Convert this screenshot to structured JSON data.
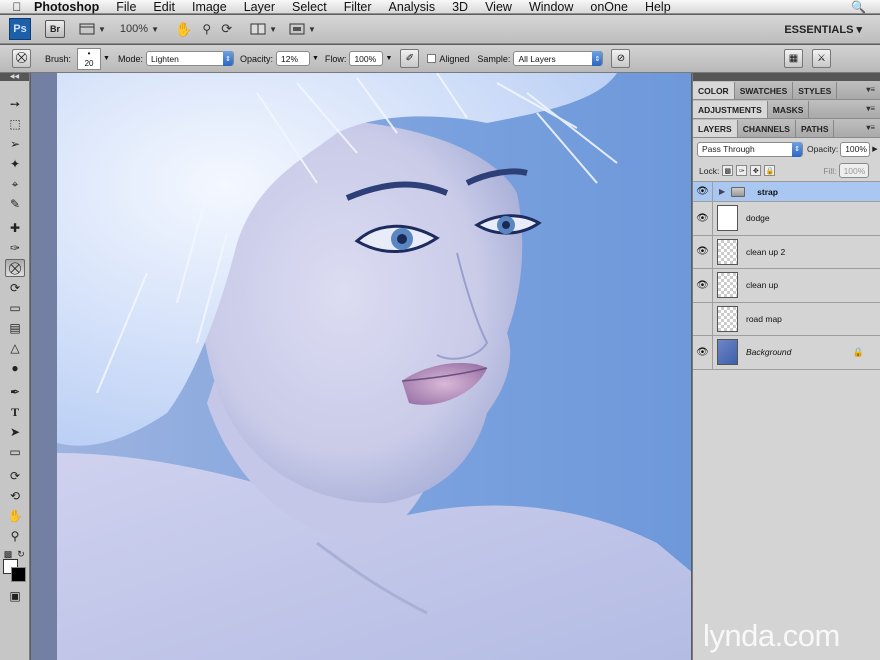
{
  "menubar": {
    "app_name": "Photoshop",
    "items": [
      "File",
      "Edit",
      "Image",
      "Layer",
      "Select",
      "Filter",
      "Analysis",
      "3D",
      "View",
      "Window",
      "onOne",
      "Help"
    ]
  },
  "appbar": {
    "ps_logo": "Ps",
    "br_logo": "Br",
    "zoom": "100%",
    "workspace": "ESSENTIALS"
  },
  "options": {
    "brush_label": "Brush:",
    "brush_size": "20",
    "mode_label": "Mode:",
    "mode_value": "Lighten",
    "opacity_label": "Opacity:",
    "opacity_value": "12%",
    "flow_label": "Flow:",
    "flow_value": "100%",
    "aligned_label": "Aligned",
    "sample_label": "Sample:",
    "sample_value": "All Layers"
  },
  "panels": {
    "color_tabs": [
      "COLOR",
      "SWATCHES",
      "STYLES"
    ],
    "adjust_tabs": [
      "ADJUSTMENTS",
      "MASKS"
    ],
    "layer_tabs": [
      "LAYERS",
      "CHANNELS",
      "PATHS"
    ],
    "blend_mode": "Pass Through",
    "opacity_label": "Opacity:",
    "opacity_value": "100%",
    "lock_label": "Lock:",
    "fill_label": "Fill:",
    "fill_value": "100%"
  },
  "layers": [
    {
      "name": "strap",
      "visible": true
    },
    {
      "name": "dodge",
      "visible": true
    },
    {
      "name": "clean up 2",
      "visible": true
    },
    {
      "name": "clean up",
      "visible": true
    },
    {
      "name": "road map",
      "visible": false
    },
    {
      "name": "Background",
      "visible": true
    }
  ],
  "watermark": "lynda.com"
}
